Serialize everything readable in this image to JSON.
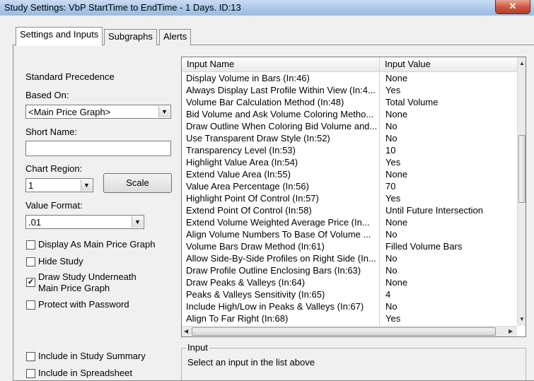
{
  "window": {
    "title": "Study Settings: VbP StartTime to EndTime - 1 Days. ID:13",
    "close_glyph": "✕"
  },
  "tabs": [
    {
      "label": "Settings and Inputs",
      "active": true
    },
    {
      "label": "Subgraphs",
      "active": false
    },
    {
      "label": "Alerts",
      "active": false
    }
  ],
  "left": {
    "standard_precedence": "Standard Precedence",
    "based_on_label": "Based On:",
    "based_on_value": "<Main Price Graph>",
    "short_name_label": "Short Name:",
    "short_name_value": "",
    "chart_region_label": "Chart Region:",
    "chart_region_value": "1",
    "scale_button": "Scale",
    "value_format_label": "Value Format:",
    "value_format_value": ".01",
    "checkboxes": [
      {
        "label": "Display As Main Price Graph",
        "checked": false
      },
      {
        "label": "Hide Study",
        "checked": false
      },
      {
        "label": "Draw Study Underneath",
        "label2": "Main Price Graph",
        "checked": true
      },
      {
        "label": "Protect with Password",
        "checked": false
      }
    ],
    "bottom_checkboxes": [
      {
        "label": "Include in Study Summary",
        "checked": false
      },
      {
        "label": "Include in Spreadsheet",
        "checked": false
      }
    ]
  },
  "grid": {
    "col_name": "Input Name",
    "col_value": "Input Value",
    "rows": [
      {
        "name": "Display Volume in Bars  (In:46)",
        "value": "None"
      },
      {
        "name": "Always Display Last Profile Within View  (In:4...",
        "value": "Yes"
      },
      {
        "name": "Volume Bar Calculation Method  (In:48)",
        "value": "Total Volume"
      },
      {
        "name": "Bid Volume and Ask Volume Coloring Metho...",
        "value": "None"
      },
      {
        "name": "Draw Outline When Coloring Bid Volume and...",
        "value": "No"
      },
      {
        "name": "Use Transparent Draw Style  (In:52)",
        "value": "No"
      },
      {
        "name": "Transparency Level  (In:53)",
        "value": "10"
      },
      {
        "name": "Highlight Value Area  (In:54)",
        "value": "Yes"
      },
      {
        "name": "Extend Value Area  (In:55)",
        "value": "None"
      },
      {
        "name": "Value Area Percentage  (In:56)",
        "value": "70"
      },
      {
        "name": "Highlight Point Of Control  (In:57)",
        "value": "Yes"
      },
      {
        "name": "Extend Point Of Control  (In:58)",
        "value": "Until Future Intersection"
      },
      {
        "name": "Extend Volume Weighted Average Price  (In...",
        "value": "None"
      },
      {
        "name": "Align Volume Numbers To Base Of Volume ...",
        "value": "No"
      },
      {
        "name": "Volume Bars Draw Method  (In:61)",
        "value": "Filled Volume Bars"
      },
      {
        "name": "Allow Side-By-Side Profiles on Right Side  (In...",
        "value": "No"
      },
      {
        "name": "Draw Profile Outline Enclosing Bars  (In:63)",
        "value": "No"
      },
      {
        "name": "Draw Peaks & Valleys  (In:64)",
        "value": "None"
      },
      {
        "name": "Peaks & Valleys Sensitivity  (In:65)",
        "value": "4"
      },
      {
        "name": "Include High/Low in Peaks & Valleys  (In:67)",
        "value": "No"
      },
      {
        "name": "Align To Far Right  (In:68)",
        "value": "Yes"
      }
    ]
  },
  "input_group": {
    "legend": "Input",
    "message": "Select an input in the list above"
  }
}
